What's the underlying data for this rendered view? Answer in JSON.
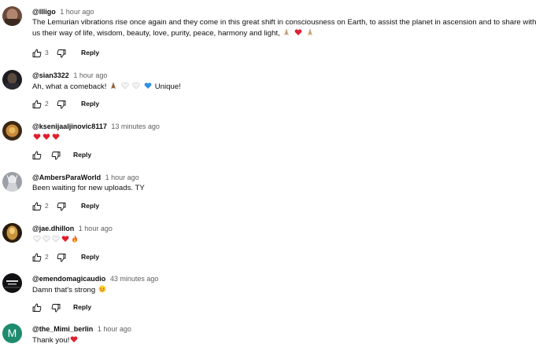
{
  "comments": [
    {
      "author": "@llligo",
      "time": "1 hour ago",
      "text": "The Lemurian vibrations rise once again and they come in this great shift in consciousness on Earth, to assist the planet in ascension and to share with us their way of life, wisdom, beauty, love, purity, peace, harmony and light,",
      "emojis": [
        "praying-hands",
        "red-heart",
        "praying-hands"
      ],
      "likes": "3",
      "reply_label": "Reply"
    },
    {
      "author": "@sian3322",
      "time": "1 hour ago",
      "text": "Ah, what a comeback!",
      "emojis": [
        "praying-hands",
        "white-heart",
        "white-heart",
        "blue-heart"
      ],
      "text_after": "Unique!",
      "likes": "2",
      "reply_label": "Reply"
    },
    {
      "author": "@ksenijaaljinovic8117",
      "time": "13 minutes ago",
      "text": "",
      "emojis": [
        "red-heart",
        "red-heart",
        "red-heart"
      ],
      "likes": "",
      "reply_label": "Reply"
    },
    {
      "author": "@AmbersParaWorld",
      "time": "1 hour ago",
      "text": "Been waiting for new uploads. TY",
      "likes": "2",
      "reply_label": "Reply"
    },
    {
      "author": "@jae.dhillon",
      "time": "1 hour ago",
      "text": "",
      "emojis": [
        "white-heart",
        "white-heart",
        "white-heart",
        "red-heart",
        "fire"
      ],
      "likes": "2",
      "reply_label": "Reply"
    },
    {
      "author": "@emendomagicaudio",
      "time": "43 minutes ago",
      "text": "Damn that's strong",
      "emojis": [
        "blushing-face"
      ],
      "likes": "",
      "reply_label": "Reply"
    },
    {
      "author": "@the_Mimi_berlin",
      "time": "1 hour ago",
      "text": "Thank you!",
      "emojis": [
        "red-heart"
      ],
      "avatar_letter": "M",
      "likes": "",
      "reply_label": ""
    }
  ],
  "colors": {
    "text": "#0f0f0f",
    "meta": "#606060",
    "avatar_letter_bg": "#1e8a6e"
  },
  "icons": [
    "thumb-up-icon",
    "thumb-down-icon"
  ]
}
